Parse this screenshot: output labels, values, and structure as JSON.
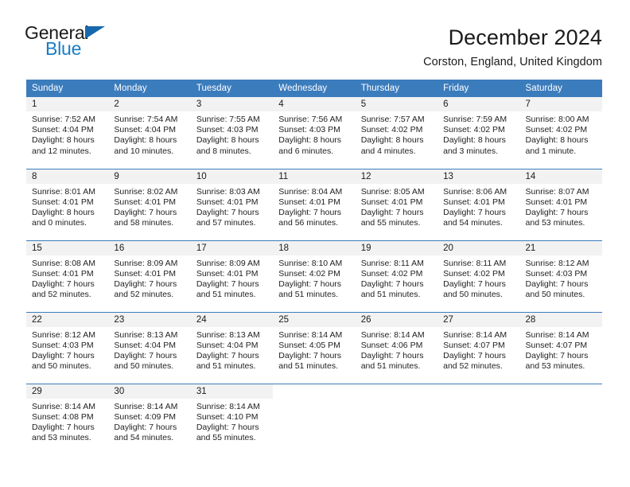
{
  "brand": {
    "name_dark": "General",
    "name_blue": "Blue",
    "triangle_icon": "triangle-icon"
  },
  "header": {
    "title": "December 2024",
    "subtitle": "Corston, England, United Kingdom"
  },
  "colors": {
    "header_blue": "#3b7cbd",
    "brand_blue": "#1a7dc4",
    "daynum_band": "#f2f2f2",
    "text": "#1b1b1b"
  },
  "weekday_headers": [
    "Sunday",
    "Monday",
    "Tuesday",
    "Wednesday",
    "Thursday",
    "Friday",
    "Saturday"
  ],
  "weeks": [
    [
      {
        "day": "1",
        "sunrise": "Sunrise: 7:52 AM",
        "sunset": "Sunset: 4:04 PM",
        "daylight_1": "Daylight: 8 hours",
        "daylight_2": "and 12 minutes."
      },
      {
        "day": "2",
        "sunrise": "Sunrise: 7:54 AM",
        "sunset": "Sunset: 4:04 PM",
        "daylight_1": "Daylight: 8 hours",
        "daylight_2": "and 10 minutes."
      },
      {
        "day": "3",
        "sunrise": "Sunrise: 7:55 AM",
        "sunset": "Sunset: 4:03 PM",
        "daylight_1": "Daylight: 8 hours",
        "daylight_2": "and 8 minutes."
      },
      {
        "day": "4",
        "sunrise": "Sunrise: 7:56 AM",
        "sunset": "Sunset: 4:03 PM",
        "daylight_1": "Daylight: 8 hours",
        "daylight_2": "and 6 minutes."
      },
      {
        "day": "5",
        "sunrise": "Sunrise: 7:57 AM",
        "sunset": "Sunset: 4:02 PM",
        "daylight_1": "Daylight: 8 hours",
        "daylight_2": "and 4 minutes."
      },
      {
        "day": "6",
        "sunrise": "Sunrise: 7:59 AM",
        "sunset": "Sunset: 4:02 PM",
        "daylight_1": "Daylight: 8 hours",
        "daylight_2": "and 3 minutes."
      },
      {
        "day": "7",
        "sunrise": "Sunrise: 8:00 AM",
        "sunset": "Sunset: 4:02 PM",
        "daylight_1": "Daylight: 8 hours",
        "daylight_2": "and 1 minute."
      }
    ],
    [
      {
        "day": "8",
        "sunrise": "Sunrise: 8:01 AM",
        "sunset": "Sunset: 4:01 PM",
        "daylight_1": "Daylight: 8 hours",
        "daylight_2": "and 0 minutes."
      },
      {
        "day": "9",
        "sunrise": "Sunrise: 8:02 AM",
        "sunset": "Sunset: 4:01 PM",
        "daylight_1": "Daylight: 7 hours",
        "daylight_2": "and 58 minutes."
      },
      {
        "day": "10",
        "sunrise": "Sunrise: 8:03 AM",
        "sunset": "Sunset: 4:01 PM",
        "daylight_1": "Daylight: 7 hours",
        "daylight_2": "and 57 minutes."
      },
      {
        "day": "11",
        "sunrise": "Sunrise: 8:04 AM",
        "sunset": "Sunset: 4:01 PM",
        "daylight_1": "Daylight: 7 hours",
        "daylight_2": "and 56 minutes."
      },
      {
        "day": "12",
        "sunrise": "Sunrise: 8:05 AM",
        "sunset": "Sunset: 4:01 PM",
        "daylight_1": "Daylight: 7 hours",
        "daylight_2": "and 55 minutes."
      },
      {
        "day": "13",
        "sunrise": "Sunrise: 8:06 AM",
        "sunset": "Sunset: 4:01 PM",
        "daylight_1": "Daylight: 7 hours",
        "daylight_2": "and 54 minutes."
      },
      {
        "day": "14",
        "sunrise": "Sunrise: 8:07 AM",
        "sunset": "Sunset: 4:01 PM",
        "daylight_1": "Daylight: 7 hours",
        "daylight_2": "and 53 minutes."
      }
    ],
    [
      {
        "day": "15",
        "sunrise": "Sunrise: 8:08 AM",
        "sunset": "Sunset: 4:01 PM",
        "daylight_1": "Daylight: 7 hours",
        "daylight_2": "and 52 minutes."
      },
      {
        "day": "16",
        "sunrise": "Sunrise: 8:09 AM",
        "sunset": "Sunset: 4:01 PM",
        "daylight_1": "Daylight: 7 hours",
        "daylight_2": "and 52 minutes."
      },
      {
        "day": "17",
        "sunrise": "Sunrise: 8:09 AM",
        "sunset": "Sunset: 4:01 PM",
        "daylight_1": "Daylight: 7 hours",
        "daylight_2": "and 51 minutes."
      },
      {
        "day": "18",
        "sunrise": "Sunrise: 8:10 AM",
        "sunset": "Sunset: 4:02 PM",
        "daylight_1": "Daylight: 7 hours",
        "daylight_2": "and 51 minutes."
      },
      {
        "day": "19",
        "sunrise": "Sunrise: 8:11 AM",
        "sunset": "Sunset: 4:02 PM",
        "daylight_1": "Daylight: 7 hours",
        "daylight_2": "and 51 minutes."
      },
      {
        "day": "20",
        "sunrise": "Sunrise: 8:11 AM",
        "sunset": "Sunset: 4:02 PM",
        "daylight_1": "Daylight: 7 hours",
        "daylight_2": "and 50 minutes."
      },
      {
        "day": "21",
        "sunrise": "Sunrise: 8:12 AM",
        "sunset": "Sunset: 4:03 PM",
        "daylight_1": "Daylight: 7 hours",
        "daylight_2": "and 50 minutes."
      }
    ],
    [
      {
        "day": "22",
        "sunrise": "Sunrise: 8:12 AM",
        "sunset": "Sunset: 4:03 PM",
        "daylight_1": "Daylight: 7 hours",
        "daylight_2": "and 50 minutes."
      },
      {
        "day": "23",
        "sunrise": "Sunrise: 8:13 AM",
        "sunset": "Sunset: 4:04 PM",
        "daylight_1": "Daylight: 7 hours",
        "daylight_2": "and 50 minutes."
      },
      {
        "day": "24",
        "sunrise": "Sunrise: 8:13 AM",
        "sunset": "Sunset: 4:04 PM",
        "daylight_1": "Daylight: 7 hours",
        "daylight_2": "and 51 minutes."
      },
      {
        "day": "25",
        "sunrise": "Sunrise: 8:14 AM",
        "sunset": "Sunset: 4:05 PM",
        "daylight_1": "Daylight: 7 hours",
        "daylight_2": "and 51 minutes."
      },
      {
        "day": "26",
        "sunrise": "Sunrise: 8:14 AM",
        "sunset": "Sunset: 4:06 PM",
        "daylight_1": "Daylight: 7 hours",
        "daylight_2": "and 51 minutes."
      },
      {
        "day": "27",
        "sunrise": "Sunrise: 8:14 AM",
        "sunset": "Sunset: 4:07 PM",
        "daylight_1": "Daylight: 7 hours",
        "daylight_2": "and 52 minutes."
      },
      {
        "day": "28",
        "sunrise": "Sunrise: 8:14 AM",
        "sunset": "Sunset: 4:07 PM",
        "daylight_1": "Daylight: 7 hours",
        "daylight_2": "and 53 minutes."
      }
    ],
    [
      {
        "day": "29",
        "sunrise": "Sunrise: 8:14 AM",
        "sunset": "Sunset: 4:08 PM",
        "daylight_1": "Daylight: 7 hours",
        "daylight_2": "and 53 minutes."
      },
      {
        "day": "30",
        "sunrise": "Sunrise: 8:14 AM",
        "sunset": "Sunset: 4:09 PM",
        "daylight_1": "Daylight: 7 hours",
        "daylight_2": "and 54 minutes."
      },
      {
        "day": "31",
        "sunrise": "Sunrise: 8:14 AM",
        "sunset": "Sunset: 4:10 PM",
        "daylight_1": "Daylight: 7 hours",
        "daylight_2": "and 55 minutes."
      },
      {
        "day": "",
        "sunrise": "",
        "sunset": "",
        "daylight_1": "",
        "daylight_2": ""
      },
      {
        "day": "",
        "sunrise": "",
        "sunset": "",
        "daylight_1": "",
        "daylight_2": ""
      },
      {
        "day": "",
        "sunrise": "",
        "sunset": "",
        "daylight_1": "",
        "daylight_2": ""
      },
      {
        "day": "",
        "sunrise": "",
        "sunset": "",
        "daylight_1": "",
        "daylight_2": ""
      }
    ]
  ]
}
